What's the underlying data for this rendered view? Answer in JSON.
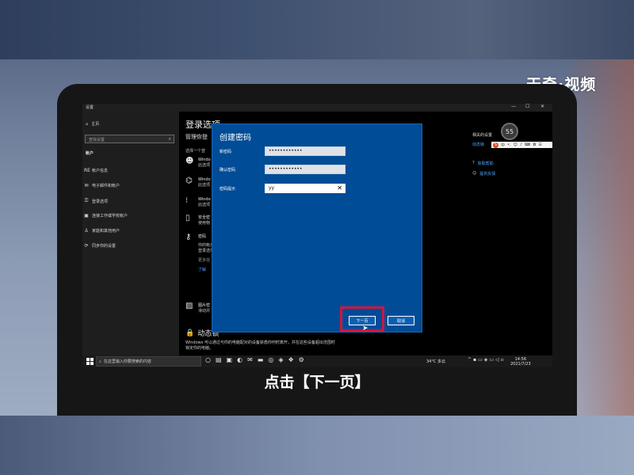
{
  "watermark": "天奇·视频",
  "caption": "点击【下一页】",
  "window": {
    "title": "设置",
    "controls": [
      "—",
      "☐",
      "✕"
    ]
  },
  "sidebar": {
    "home": "主页",
    "search_placeholder": "查找设置",
    "section": "帐户",
    "items": [
      {
        "icon": "account-info-icon",
        "glyph": "RE",
        "label": "帐户信息"
      },
      {
        "icon": "email-icon",
        "glyph": "✉",
        "label": "电子邮件和帐户"
      },
      {
        "icon": "key-icon",
        "glyph": "⚿",
        "label": "登录选项"
      },
      {
        "icon": "briefcase-icon",
        "glyph": "▣",
        "label": "连接工作或学校帐户"
      },
      {
        "icon": "family-icon",
        "glyph": "♙",
        "label": "家庭和其他用户"
      },
      {
        "icon": "sync-icon",
        "glyph": "⟳",
        "label": "同步你的设置"
      }
    ]
  },
  "content": {
    "title": "登录选项",
    "subtitle": "管理你登",
    "hint": "选择一个登",
    "options": [
      {
        "icon": "face-icon",
        "glyph": "☻",
        "name": "Windo",
        "desc": "此选项"
      },
      {
        "icon": "fingerprint-icon",
        "glyph": "⌬",
        "name": "Windo",
        "desc": "此选项"
      },
      {
        "icon": "pin-icon",
        "glyph": "⁝",
        "name": "Windo",
        "desc": "此选项"
      },
      {
        "icon": "security-key-icon",
        "glyph": "▯",
        "name": "安全密",
        "desc": "使用物"
      },
      {
        "icon": "password-icon",
        "glyph": "⚷",
        "name": "密码",
        "desc": "你的帐户",
        "extra": "登录选项",
        "more": "更多信",
        "link": "了解"
      },
      {
        "icon": "picture-password-icon",
        "glyph": "▨",
        "name": "图片密",
        "desc": "滑动并"
      }
    ],
    "dynamic_lock_title": "动态锁",
    "windows_text": "Windows 可以通过与你的电脑配对的设备获悉你何时离开，并在这些设备超出范围时锁定你的电脑。"
  },
  "right_panel": {
    "related_title": "相关的设置",
    "related_link": "动态锁",
    "badge": "55",
    "help_items": [
      {
        "icon": "help-icon",
        "label": "获取帮助"
      },
      {
        "icon": "feedback-icon",
        "label": "提供反馈"
      }
    ]
  },
  "dialog": {
    "title": "创建密码",
    "fields": [
      {
        "label": "新密码",
        "value": "••••••••••••"
      },
      {
        "label": "确认密码",
        "value": "••••••••••••"
      },
      {
        "label": "密码提示",
        "value": "yy"
      }
    ],
    "next_label": "下一页",
    "cancel_label": "取消"
  },
  "taskbar": {
    "search_placeholder": "在这里输入你要搜索的内容",
    "weather": "34°C 多云",
    "time": "14:56",
    "date": "2021/7/23"
  },
  "colors": {
    "dialog_bg": "#004c97",
    "highlight": "#d3153c",
    "link": "#4aa3ff"
  }
}
